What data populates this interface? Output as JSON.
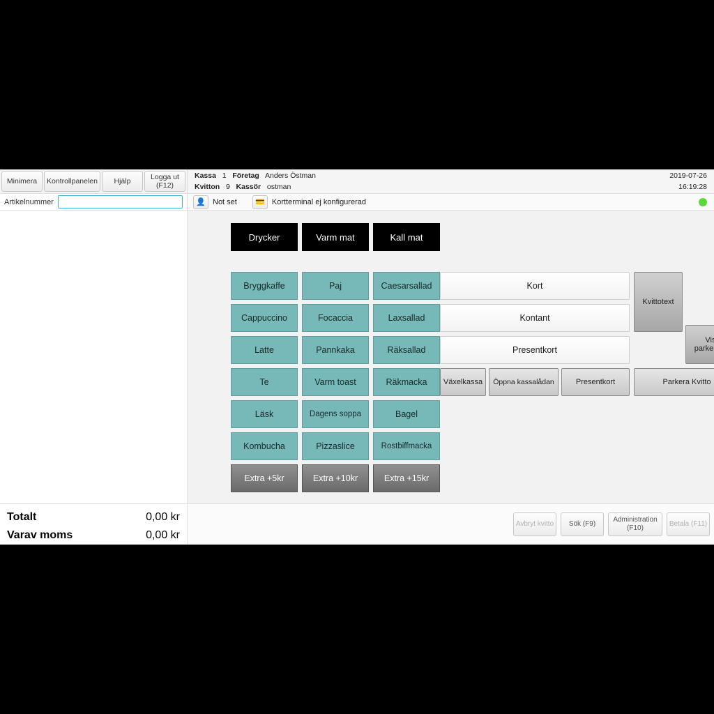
{
  "toolbar": {
    "minimize": "Minimera",
    "control_panel": "Kontrollpanelen",
    "help": "Hjälp",
    "logout": "Logga ut (F12)"
  },
  "header": {
    "kassa_label": "Kassa",
    "kassa_value": "1",
    "foretag_label": "Företag",
    "foretag_value": "Anders Östman",
    "kvitton_label": "Kvitton",
    "kvitton_value": "9",
    "kassor_label": "Kassör",
    "kassor_value": "ostman",
    "date": "2019-07-26",
    "time": "16:19:28"
  },
  "sku": {
    "label": "Artikelnummer",
    "value": ""
  },
  "status": {
    "not_set": "Not set",
    "terminal": "Kortterminal ej konfigurerad"
  },
  "categories": [
    "Drycker",
    "Varm mat",
    "Kall mat"
  ],
  "products": [
    [
      "Bryggkaffe",
      "Paj",
      "Caesarsallad"
    ],
    [
      "Cappuccino",
      "Focaccia",
      "Laxsallad"
    ],
    [
      "Latte",
      "Pannkaka",
      "Räksallad"
    ],
    [
      "Te",
      "Varm toast",
      "Räkmacka"
    ],
    [
      "Läsk",
      "Dagens soppa",
      "Bagel"
    ],
    [
      "Kombucha",
      "Pizzaslice",
      "Rostbiffmacka"
    ]
  ],
  "extras": [
    "Extra +5kr",
    "Extra +10kr",
    "Extra +15kr"
  ],
  "pay": {
    "kort": "Kort",
    "kontant": "Kontant",
    "presentkort_big": "Presentkort",
    "kvittotext": "Kvittotext",
    "visa_parkerad": "Visa parkerad...",
    "vaxelkassa": "Växelkassa",
    "oppna": "Öppna kassalådan",
    "presentkort_small": "Presentkort",
    "parkera": "Parkera Kvitto"
  },
  "totals": {
    "totalt_label": "Totalt",
    "totalt_value": "0,00 kr",
    "moms_label": "Varav moms",
    "moms_value": "0,00 kr"
  },
  "footer": {
    "avbryt": "Avbryt kvitto",
    "sok": "Sök (F9)",
    "admin": "Administration (F10)",
    "betala": "Betala (F11)"
  }
}
